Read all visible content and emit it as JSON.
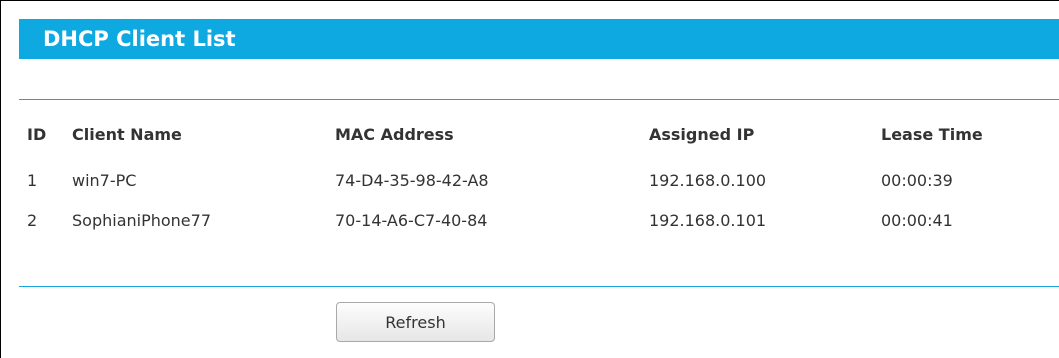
{
  "title": "DHCP Client List",
  "table": {
    "headers": {
      "id": "ID",
      "client_name": "Client Name",
      "mac_address": "MAC Address",
      "assigned_ip": "Assigned IP",
      "lease_time": "Lease Time"
    },
    "rows": [
      {
        "id": "1",
        "client_name": "win7-PC",
        "mac_address": "74-D4-35-98-42-A8",
        "assigned_ip": "192.168.0.100",
        "lease_time": "00:00:39"
      },
      {
        "id": "2",
        "client_name": "SophianiPhone77",
        "mac_address": "70-14-A6-C7-40-84",
        "assigned_ip": "192.168.0.101",
        "lease_time": "00:00:41"
      }
    ]
  },
  "buttons": {
    "refresh_label": "Refresh"
  },
  "colors": {
    "title_bar": "#0fa9e1",
    "divider": "#1aa5dc",
    "text": "#333333"
  }
}
